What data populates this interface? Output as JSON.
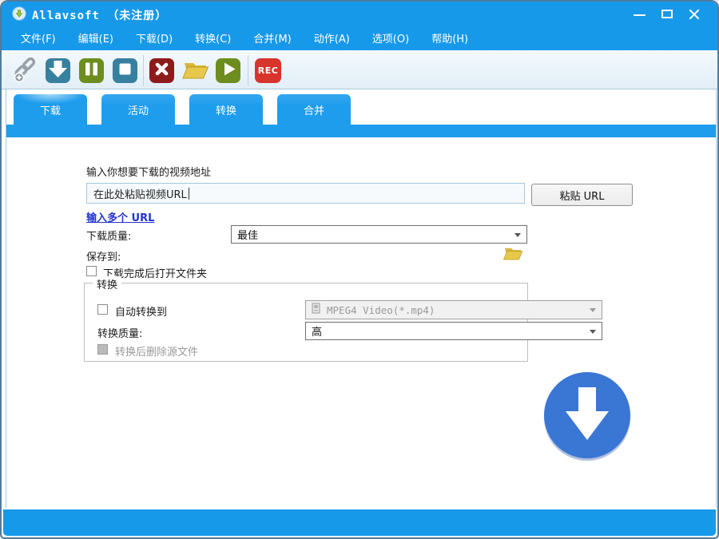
{
  "window": {
    "title": "Allavsoft （未注册）"
  },
  "menu": {
    "items": [
      {
        "label": "文件(F)"
      },
      {
        "label": "编辑(E)"
      },
      {
        "label": "下载(D)"
      },
      {
        "label": "转换(C)"
      },
      {
        "label": "合并(M)"
      },
      {
        "label": "动作(A)"
      },
      {
        "label": "选项(O)"
      },
      {
        "label": "帮助(H)"
      }
    ]
  },
  "toolbar": {
    "buttons": [
      {
        "name": "add-url",
        "icon": "link-plus-icon"
      },
      {
        "name": "download",
        "icon": "arrow-down-icon"
      },
      {
        "name": "pause",
        "icon": "pause-icon"
      },
      {
        "name": "stop",
        "icon": "stop-icon"
      },
      {
        "name": "delete",
        "icon": "x-mark-icon"
      },
      {
        "name": "open-folder",
        "icon": "folder-icon"
      },
      {
        "name": "play",
        "icon": "play-icon"
      },
      {
        "name": "record",
        "icon": "rec-badge",
        "label": "REC"
      }
    ]
  },
  "tabs": [
    {
      "label": "下载",
      "active": true
    },
    {
      "label": "活动",
      "active": false
    },
    {
      "label": "转换",
      "active": false
    },
    {
      "label": "合并",
      "active": false
    }
  ],
  "download_panel": {
    "url_label": "输入你想要下载的视频地址",
    "url_placeholder": "在此处粘贴视频URL",
    "paste_button_label": "粘贴 URL",
    "multiple_url_link": "输入多个 URL",
    "quality_label": "下载质量:",
    "quality_value": "最佳",
    "save_to_label": "保存到:",
    "open_folder_after_download_label": "下载完成后打开文件夹",
    "open_folder_after_download_checked": false,
    "convert_group": {
      "title": "转换",
      "auto_convert_label": "自动转换到",
      "auto_convert_checked": false,
      "format_value": "MPEG4 Video(*.mp4)",
      "quality_label": "转换质量:",
      "quality_value": "高",
      "delete_source_label": "转换后删除源文件",
      "delete_source_checked": false
    }
  },
  "colors": {
    "titlebar_blue": "#1799EA",
    "tab_blue": "#1E9DED",
    "toolbar_bg": "#EAF3FB",
    "download_circle_blue": "#3A76D4",
    "icon_steel_blue": "#38809F",
    "icon_olive_green": "#6D8E1E",
    "icon_dark_red": "#8E1B1B",
    "icon_rec_red": "#D8342C",
    "folder_yellow": "#E8C84A",
    "link_blue": "#2433CC"
  }
}
